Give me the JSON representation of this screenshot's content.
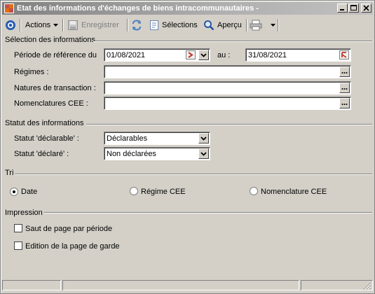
{
  "window": {
    "title": "Etat des informations d'échanges de biens intracommunautaires -"
  },
  "toolbar": {
    "actions_label": "Actions",
    "save_label": "Enregistrer",
    "selections_label": "Sélections",
    "preview_label": "Aperçu"
  },
  "selection": {
    "title": "Sélection des informations",
    "period_label": "Période de référence du",
    "period_from": "01/08/2021",
    "period_to_label": "au :",
    "period_to": "31/08/2021",
    "regimes_label": "Régimes :",
    "regimes_value": "",
    "natures_label": "Natures de transaction :",
    "natures_value": "",
    "nomenclatures_label": "Nomenclatures CEE :",
    "nomenclatures_value": ""
  },
  "status": {
    "title": "Statut des informations",
    "declarable_label": "Statut 'déclarable' :",
    "declarable_value": "Déclarables",
    "declared_label": "Statut 'déclaré' :",
    "declared_value": "Non déclarées"
  },
  "sort": {
    "title": "Tri",
    "options": [
      "Date",
      "Régime CEE",
      "Nomenclature CEE"
    ],
    "selected": "Date"
  },
  "print": {
    "title": "Impression",
    "page_break_label": "Saut de page par période",
    "cover_page_label": "Edition de la page de garde",
    "page_break_checked": false,
    "cover_page_checked": false
  },
  "colors": {
    "title_gradient_start": "#808080",
    "face": "#d4d0c8",
    "accent_blue": "#2a5db0"
  }
}
